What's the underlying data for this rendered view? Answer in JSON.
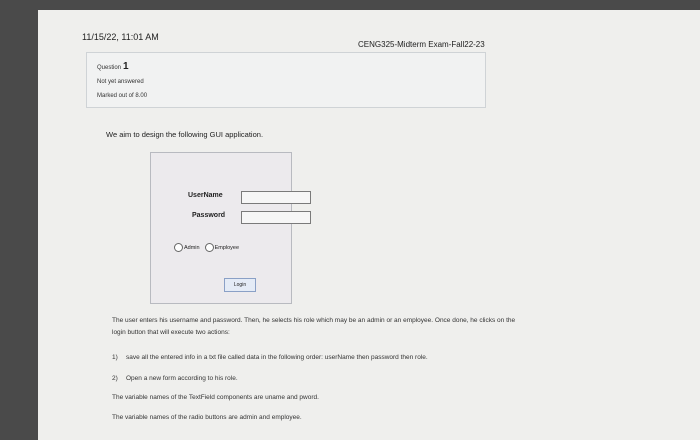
{
  "header": {
    "date_time": "11/15/22, 11:01 AM",
    "title": "CENG325-Midterm Exam-Fall22-23"
  },
  "question_info": {
    "label": "Question",
    "number": "1",
    "status": "Not yet answered",
    "marks": "Marked out of 8.00"
  },
  "intro": "We aim to design the following GUI application.",
  "gui": {
    "username_label": "UserName",
    "password_label": "Password",
    "radio_admin": "Admin",
    "radio_employee": "Employee",
    "login_button": "Login"
  },
  "description": {
    "para1_line1": "The user enters his username and password. Then, he selects his role which may be an admin or an employee. Once done, he clicks on the",
    "para1_line2": "login button that will execute two actions:",
    "item1_num": "1)",
    "item1": "save all the entered info in a txt file called data in the following order: userName then password then role.",
    "item2_num": "2)",
    "item2": "Open a new form according to his role.",
    "line3": "The variable names of the TextField components are uname and pword.",
    "line4": "The variable names of the radio buttons are admin and employee."
  }
}
